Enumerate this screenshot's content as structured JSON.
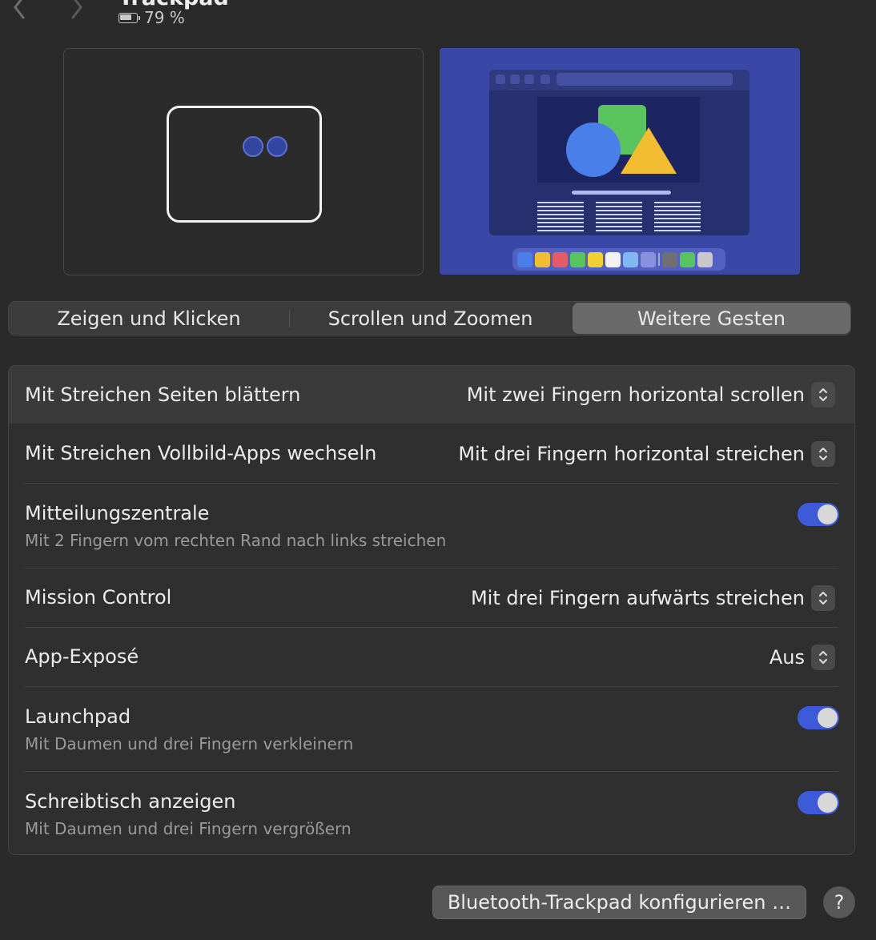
{
  "header": {
    "title": "Trackpad",
    "battery_text": "79 %",
    "battery_level_pct": 79,
    "back_icon": "chevron-left-icon",
    "forward_icon": "chevron-right-icon"
  },
  "tabs": [
    {
      "label": "Zeigen und Klicken",
      "active": false
    },
    {
      "label": "Scrollen und Zoomen",
      "active": false
    },
    {
      "label": "Weitere Gesten",
      "active": true
    }
  ],
  "settings": [
    {
      "label": "Mit Streichen Seiten blättern",
      "type": "popup",
      "value": "Mit zwei Fingern horizontal scrollen"
    },
    {
      "label": "Mit Streichen Vollbild-Apps wechseln",
      "type": "popup",
      "value": "Mit drei Fingern horizontal streichen"
    },
    {
      "label": "Mitteilungszentrale",
      "subtitle": "Mit 2 Fingern vom rechten Rand nach links streichen",
      "type": "toggle",
      "on": true
    },
    {
      "label": "Mission Control",
      "type": "popup",
      "value": "Mit drei Fingern aufwärts streichen"
    },
    {
      "label": "App-Exposé",
      "type": "popup",
      "value": "Aus"
    },
    {
      "label": "Launchpad",
      "subtitle": "Mit Daumen und drei Fingern verkleinern",
      "type": "toggle",
      "on": true
    },
    {
      "label": "Schreibtisch anzeigen",
      "subtitle": "Mit Daumen und drei Fingern vergrößern",
      "type": "toggle",
      "on": true
    }
  ],
  "footer": {
    "configure_button": "Bluetooth-Trackpad konfigurieren …",
    "help_button": "?"
  },
  "colors": {
    "background": "#2a2a2a",
    "accent_toggle": "#3d5bd8",
    "preview_blue": "#3947a6"
  }
}
